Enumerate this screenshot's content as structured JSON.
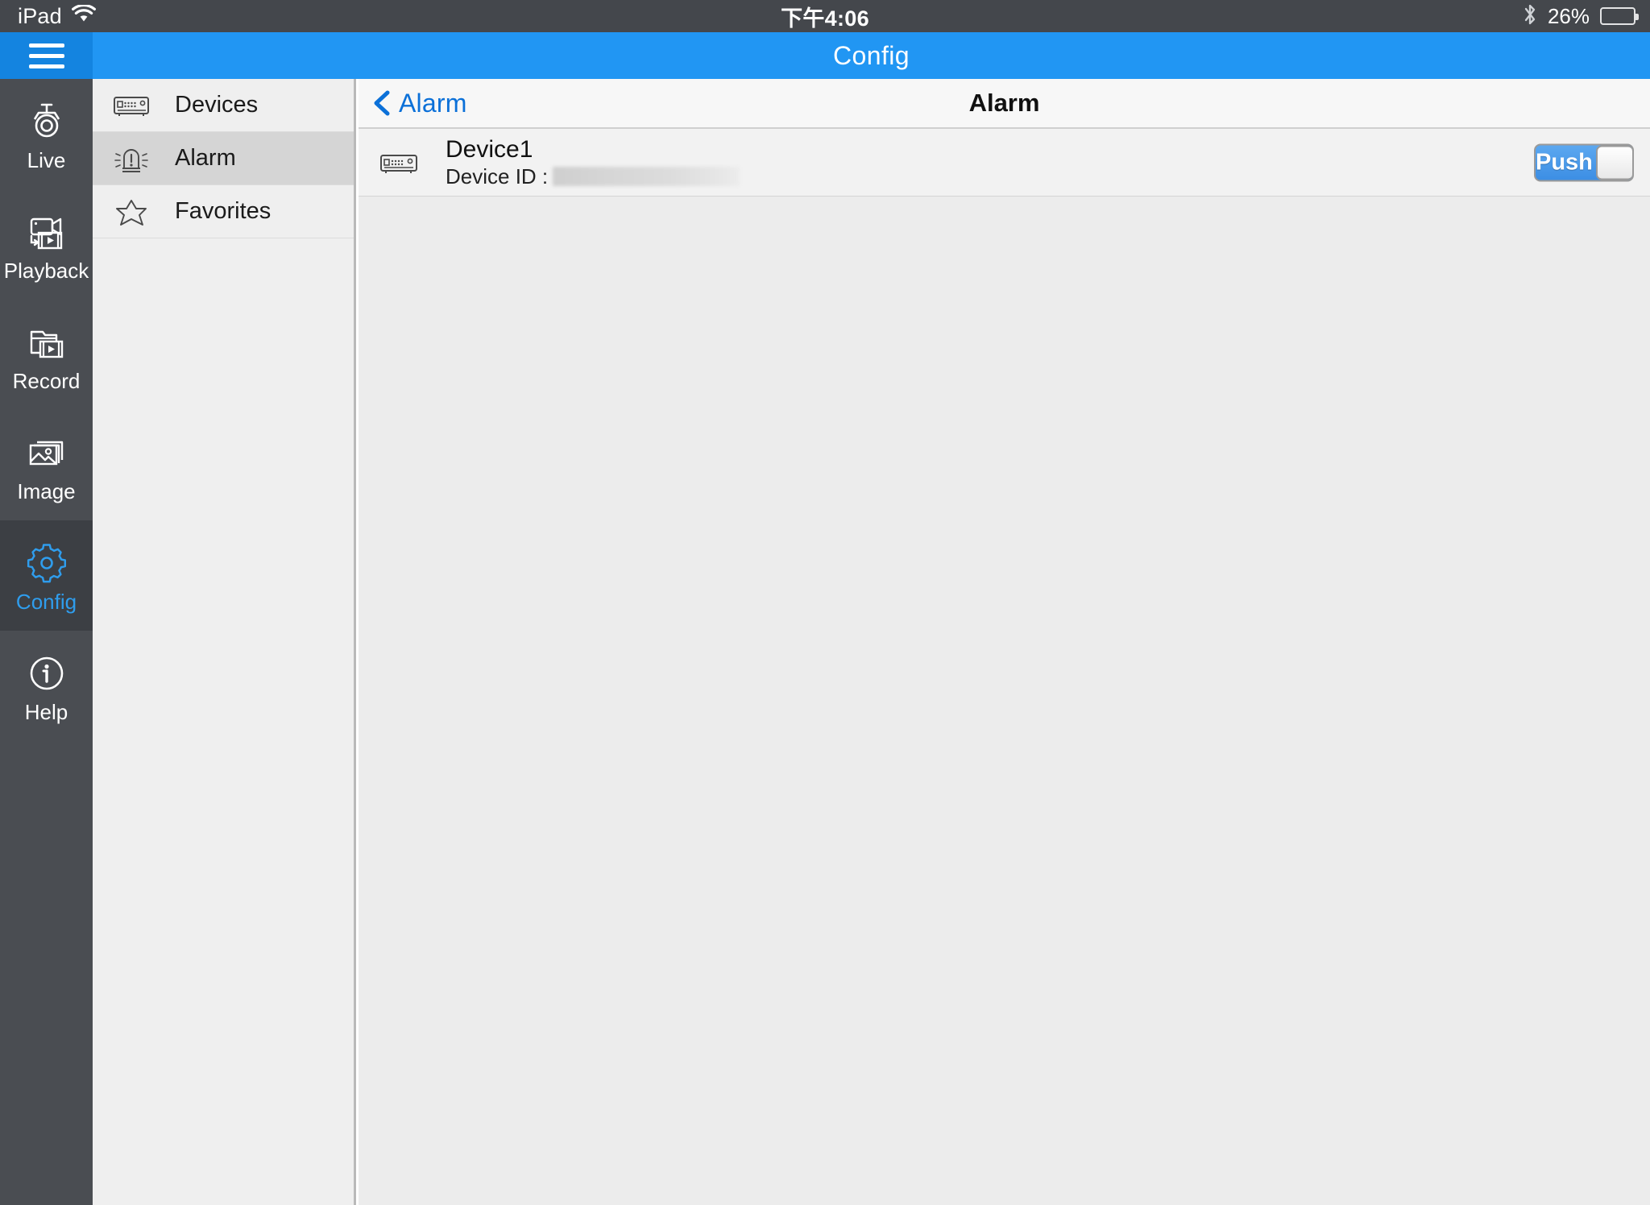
{
  "status_bar": {
    "carrier": "iPad",
    "wifi_icon": "wifi-icon",
    "time": "下午4:06",
    "bluetooth_icon": "bluetooth-icon",
    "battery_percent": "26%",
    "battery_level": 26
  },
  "top_bar": {
    "menu_icon": "hamburger-menu-icon",
    "title": "Config",
    "accent_color": "#2196f3"
  },
  "rail": {
    "items": [
      {
        "label": "Live",
        "icon": "dome-camera-icon",
        "active": false
      },
      {
        "label": "Playback",
        "icon": "camcorder-film-play-icon",
        "active": false
      },
      {
        "label": "Record",
        "icon": "folder-film-play-icon",
        "active": false
      },
      {
        "label": "Image",
        "icon": "photo-stack-icon",
        "active": false
      },
      {
        "label": "Config",
        "icon": "gear-icon",
        "active": true
      },
      {
        "label": "Help",
        "icon": "info-circle-icon",
        "active": false
      }
    ],
    "active_color": "#2f9ded"
  },
  "menu_panel": {
    "items": [
      {
        "label": "Devices",
        "icon": "dvr-device-icon",
        "active": false
      },
      {
        "label": "Alarm",
        "icon": "alarm-siren-icon",
        "active": true
      },
      {
        "label": "Favorites",
        "icon": "star-icon",
        "active": false
      }
    ]
  },
  "content": {
    "back_label": "Alarm",
    "back_icon": "chevron-left-icon",
    "title": "Alarm",
    "rows": [
      {
        "icon": "dvr-device-icon",
        "name": "Device1",
        "id_label": "Device ID :",
        "id_value": "",
        "toggle_label": "Push",
        "toggle_on": true
      }
    ]
  }
}
